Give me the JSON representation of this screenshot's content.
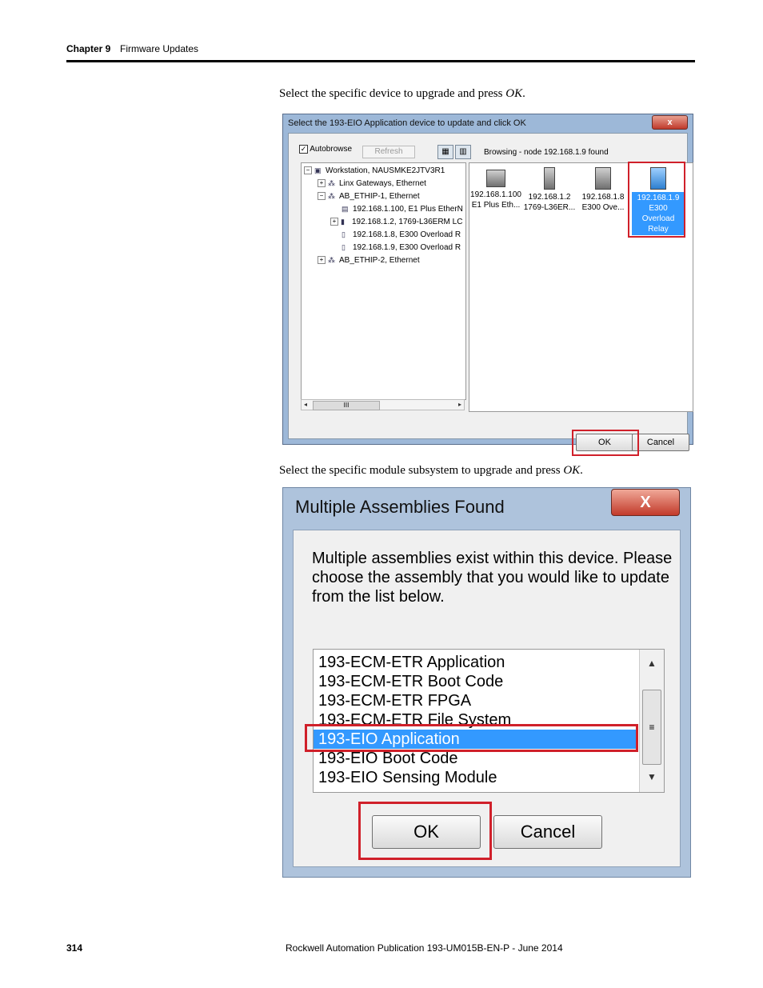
{
  "header": {
    "chapter": "Chapter 9",
    "section": "Firmware Updates"
  },
  "instructions": {
    "step1": {
      "text": "Select the specific device to upgrade and press ",
      "emph": "OK",
      "end": "."
    },
    "step2": {
      "text": "Select the specific module subsystem to upgrade and press ",
      "emph": "OK",
      "end": "."
    }
  },
  "dialog1": {
    "title": "Select the 193-EIO Application device to update and click OK",
    "close_label": "x",
    "autobrowse_label": "Autobrowse",
    "autobrowse_check": "✓",
    "refresh_label": "Refresh",
    "status": "Browsing - node 192.168.1.9 found",
    "tree": [
      "Workstation, NAUSMKE2JTV3R1",
      "Linx Gateways, Ethernet",
      "AB_ETHIP-1, Ethernet",
      "192.168.1.100, E1 Plus EtherN",
      "192.168.1.2, 1769-L36ERM LC",
      "192.168.1.8, E300 Overload R",
      "192.168.1.9, E300 Overload R",
      "AB_ETHIP-2, Ethernet"
    ],
    "scroll_thumb": "III",
    "scroll_left": "◂",
    "scroll_right": "▸",
    "devices": [
      {
        "ip": "192.168.1.100",
        "desc": "E1 Plus Eth..."
      },
      {
        "ip": "192.168.1.2",
        "desc": "1769-L36ER..."
      },
      {
        "ip": "192.168.1.8",
        "desc": "E300 Ove..."
      },
      {
        "ip": "192.168.1.9",
        "desc": "E300",
        "desc2": "Overload",
        "desc3": "Relay"
      }
    ],
    "ok_label": "OK",
    "cancel_label": "Cancel"
  },
  "dialog2": {
    "title": "Multiple Assemblies Found",
    "close_label": "X",
    "message_lines": [
      "Multiple assemblies exist within this device. Please",
      "choose the assembly that you would like to update",
      "from the list below."
    ],
    "items": [
      "193-ECM-ETR Application",
      "193-ECM-ETR Boot Code",
      "193-ECM-ETR FPGA",
      "193-ECM-ETR File System",
      "193-EIO Application",
      "193-EIO Boot Code",
      "193-EIO Sensing Module"
    ],
    "selected_index": 4,
    "scroll_up": "▲",
    "scroll_down": "▼",
    "scroll_grip": "≡",
    "ok_label": "OK",
    "cancel_label": "Cancel"
  },
  "footer": {
    "page_number": "314",
    "publication": "Rockwell Automation Publication 193-UM015B-EN-P - June 2014"
  },
  "colors": {
    "highlight_box": "#d0202a",
    "selection": "#3399ff"
  }
}
